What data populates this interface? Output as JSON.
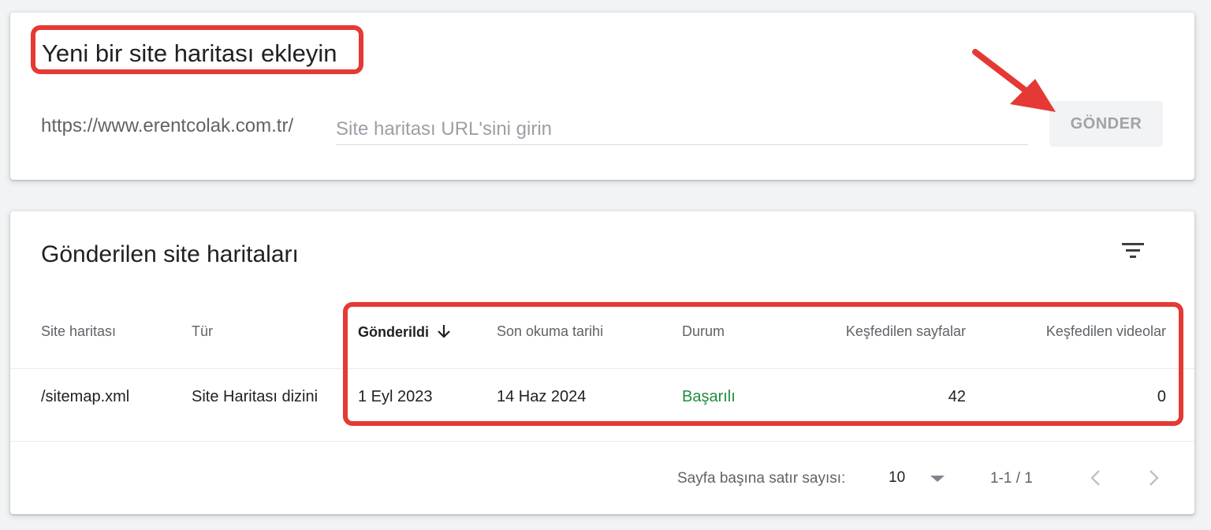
{
  "add_sitemap": {
    "title": "Yeni bir site haritası ekleyin",
    "url_prefix": "https://www.erentcolak.com.tr/",
    "input_placeholder": "Site haritası URL'sini girin",
    "input_value": "",
    "submit_label": "GÖNDER"
  },
  "submitted": {
    "title": "Gönderilen site haritaları",
    "filter_icon": "filter-list-icon",
    "columns": [
      {
        "label": "Site haritası"
      },
      {
        "label": "Tür"
      },
      {
        "label": "Gönderildi",
        "sorted": "descending"
      },
      {
        "label": "Son okuma tarihi"
      },
      {
        "label": "Durum"
      },
      {
        "label": "Keşfedilen sayfalar"
      },
      {
        "label": "Keşfedilen videolar"
      }
    ],
    "rows": [
      {
        "sitemap": "/sitemap.xml",
        "type": "Site Haritası dizini",
        "submitted": "1 Eyl 2023",
        "last_read": "14 Haz 2024",
        "status": "Başarılı",
        "pages": "42",
        "videos": "0"
      }
    ],
    "pagination": {
      "rows_per_page_label": "Sayfa başına satır sayısı:",
      "rows_per_page": "10",
      "range": "1-1 / 1"
    }
  },
  "colors": {
    "highlight": "#e53935",
    "status_success": "#1e8e3e",
    "page_background": "#f1f3f4"
  }
}
